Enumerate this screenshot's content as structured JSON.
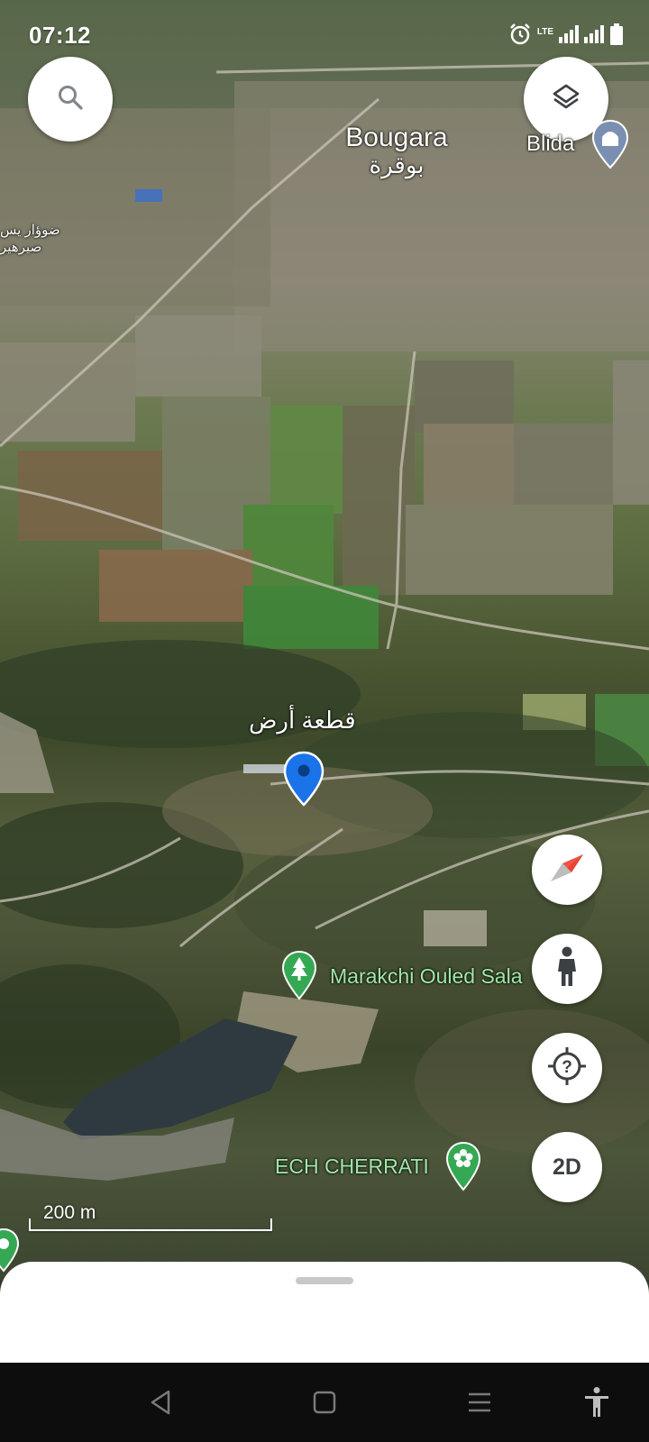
{
  "status_bar": {
    "time": "07:12",
    "network": "LTE",
    "icons": [
      "alarm-icon",
      "lte-icon",
      "signal-icon",
      "signal-icon",
      "battery-icon"
    ]
  },
  "map": {
    "places": [
      {
        "name": "Bougara",
        "name_ar": "بوقرة"
      },
      {
        "name": "Blida"
      }
    ],
    "edge_label_lines": [
      "ضوؤار يس",
      "صيرهير"
    ],
    "pinned_place": "قطعة أرض",
    "pois": [
      {
        "name": "Marakchi Ouled Sala",
        "icon": "tree-icon"
      },
      {
        "name": "ECH CHERRATI",
        "icon": "flower-icon"
      }
    ],
    "scale_label": "200 m"
  },
  "controls": {
    "search_icon": "search-icon",
    "layers_icon": "layers-icon",
    "compass_icon": "compass-icon",
    "street_view_icon": "pegman-icon",
    "my_location_icon": "my-location-icon",
    "view_mode_label": "2D"
  },
  "colors": {
    "pin_blue": "#1a73e8",
    "poi_green": "#34a853",
    "poi_label_green": "#9fe8a6",
    "compass_red": "#ea4335"
  },
  "nav_bar": {
    "icons": [
      "back-icon",
      "home-icon",
      "recents-icon",
      "accessibility-icon"
    ]
  }
}
